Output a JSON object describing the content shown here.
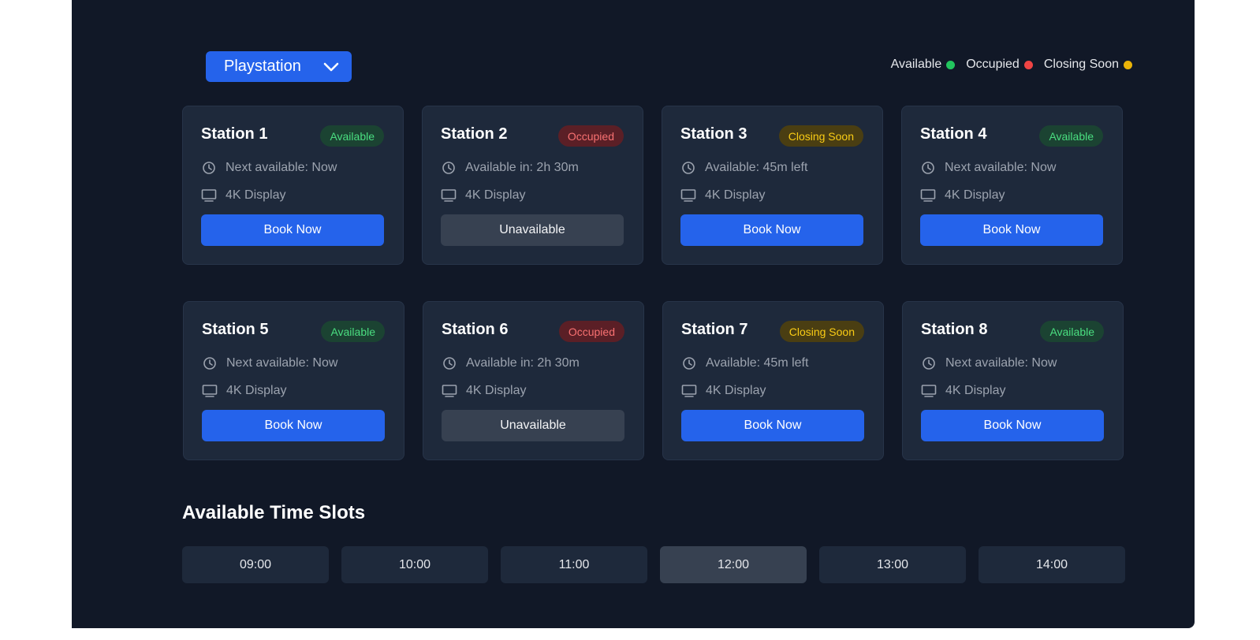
{
  "console_select": {
    "value": "Playstation",
    "icon": "chevron-down-icon"
  },
  "legend": [
    {
      "label": "Available",
      "color": "#22c55e"
    },
    {
      "label": "Occupied",
      "color": "#ef4444"
    },
    {
      "label": "Closing Soon",
      "color": "#eab308"
    }
  ],
  "stations": [
    {
      "name": "Station 1",
      "status": "Available",
      "status_type": "available",
      "availability": "Next available: Now",
      "display": "4K Display",
      "action": "Book Now",
      "action_type": "book"
    },
    {
      "name": "Station 2",
      "status": "Occupied",
      "status_type": "occupied",
      "availability": "Available in: 2h 30m",
      "display": "4K Display",
      "action": "Unavailable",
      "action_type": "unavailable"
    },
    {
      "name": "Station 3",
      "status": "Closing Soon",
      "status_type": "closing",
      "availability": "Available: 45m left",
      "display": "4K Display",
      "action": "Book Now",
      "action_type": "book"
    },
    {
      "name": "Station 4",
      "status": "Available",
      "status_type": "available",
      "availability": "Next available: Now",
      "display": "4K Display",
      "action": "Book Now",
      "action_type": "book"
    },
    {
      "name": "Station 5",
      "status": "Available",
      "status_type": "available",
      "availability": "Next available: Now",
      "display": "4K Display",
      "action": "Book Now",
      "action_type": "book"
    },
    {
      "name": "Station 6",
      "status": "Occupied",
      "status_type": "occupied",
      "availability": "Available in: 2h 30m",
      "display": "4K Display",
      "action": "Unavailable",
      "action_type": "unavailable"
    },
    {
      "name": "Station 7",
      "status": "Closing Soon",
      "status_type": "closing",
      "availability": "Available: 45m left",
      "display": "4K Display",
      "action": "Book Now",
      "action_type": "book"
    },
    {
      "name": "Station 8",
      "status": "Available",
      "status_type": "available",
      "availability": "Next available: Now",
      "display": "4K Display",
      "action": "Book Now",
      "action_type": "book"
    }
  ],
  "time_slots": {
    "title": "Available Time Slots",
    "slots": [
      "09:00",
      "10:00",
      "11:00",
      "12:00",
      "13:00",
      "14:00"
    ],
    "selected": "12:00"
  }
}
